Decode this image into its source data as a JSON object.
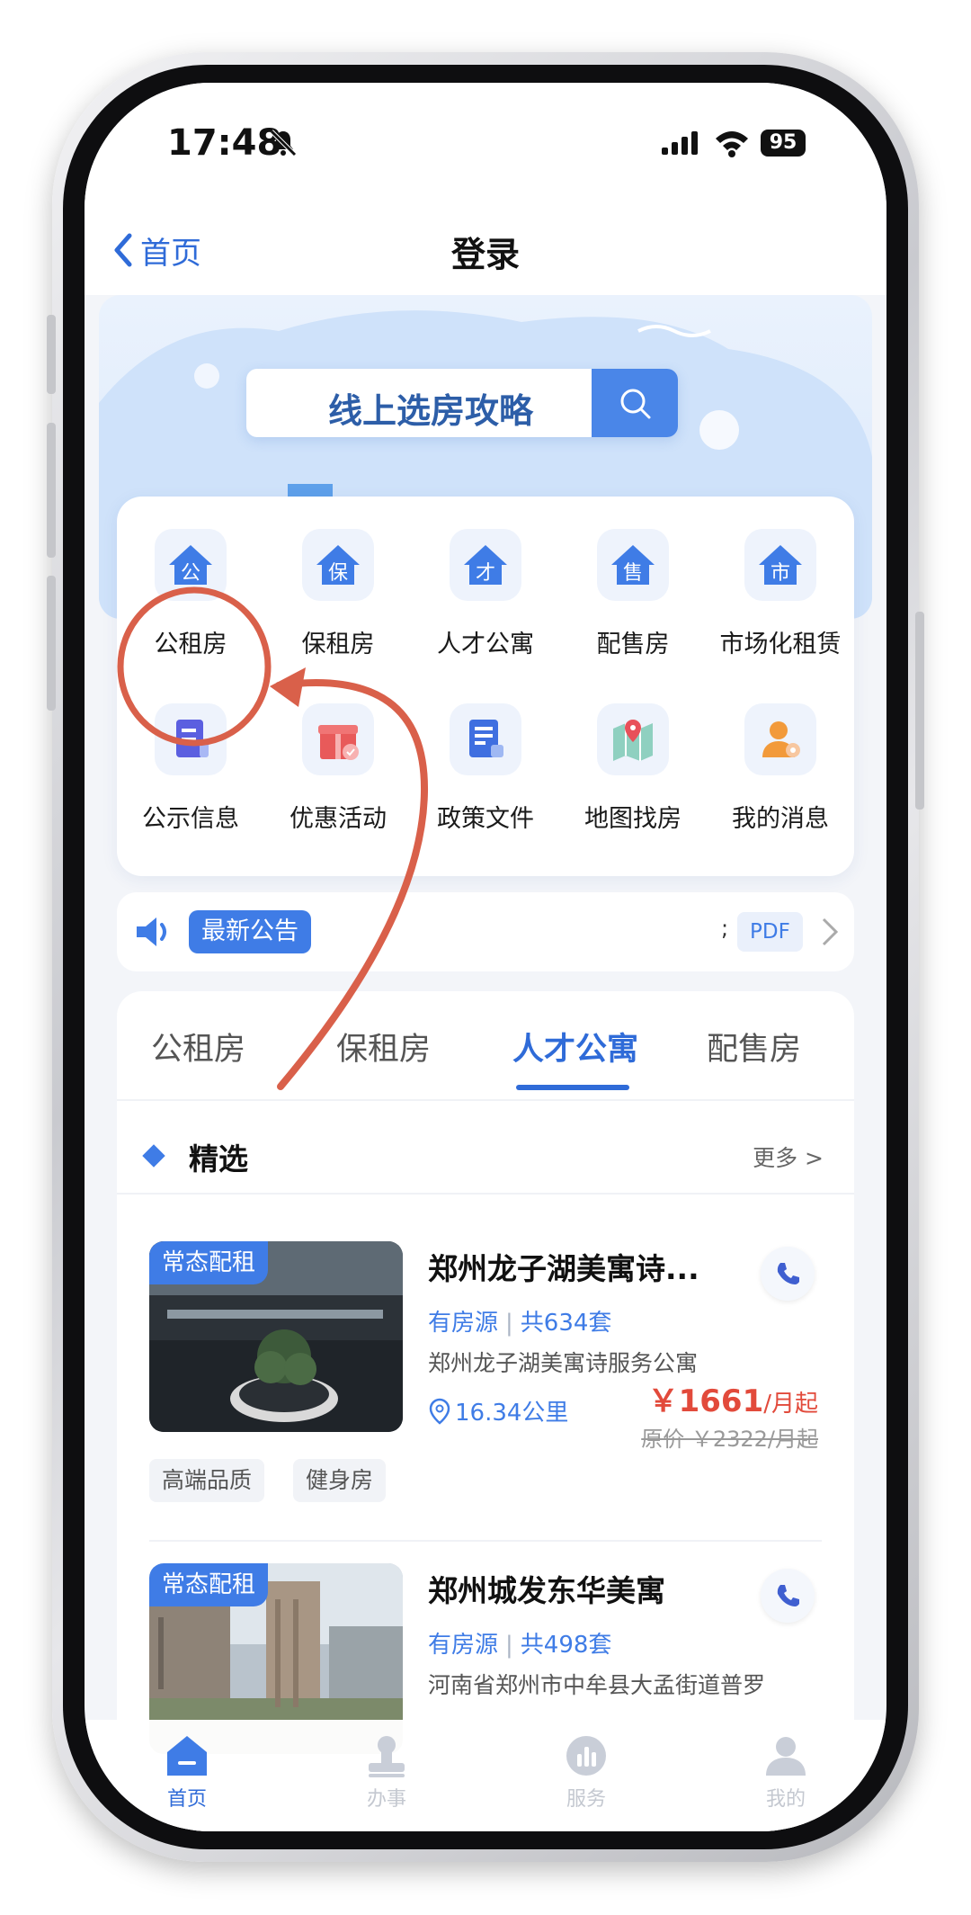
{
  "status_bar": {
    "time": "17:48",
    "battery": "95"
  },
  "nav": {
    "back_label": "首页",
    "title": "登录"
  },
  "banner": {
    "search_placeholder": "线上选房攻略"
  },
  "menu": {
    "items": [
      {
        "label": "公租房",
        "glyph": "公",
        "icon": "house-gong-icon"
      },
      {
        "label": "保租房",
        "glyph": "保",
        "icon": "house-bao-icon"
      },
      {
        "label": "人才公寓",
        "glyph": "才",
        "icon": "house-cai-icon"
      },
      {
        "label": "配售房",
        "glyph": "售",
        "icon": "house-shou-icon"
      },
      {
        "label": "市场化租赁",
        "glyph": "市",
        "icon": "house-shi-icon"
      },
      {
        "label": "公示信息",
        "icon": "document-icon"
      },
      {
        "label": "优惠活动",
        "icon": "gift-icon"
      },
      {
        "label": "政策文件",
        "icon": "policy-file-icon"
      },
      {
        "label": "地图找房",
        "icon": "map-icon"
      },
      {
        "label": "我的消息",
        "icon": "user-message-icon"
      }
    ]
  },
  "notice": {
    "badge": "最新公告",
    "text_fragment": ";",
    "pdf": "PDF"
  },
  "tabs": [
    "公租房",
    "保租房",
    "人才公寓",
    "配售房"
  ],
  "active_tab": "人才公寓",
  "section": {
    "title": "精选",
    "more": "更多 >"
  },
  "listings": [
    {
      "tag": "常态配租",
      "name": "郑州龙子湖美寓诗...",
      "availability": "有房源",
      "count": "共634套",
      "address": "郑州龙子湖美寓诗服务公寓",
      "distance": "16.34公里",
      "price": "￥1661",
      "price_unit": "/月起",
      "original_price": "原价 ￥2322/月起",
      "features": [
        "高端品质",
        "健身房"
      ]
    },
    {
      "tag": "常态配租",
      "name": "郑州城发东华美寓",
      "availability": "有房源",
      "count": "共498套",
      "address": "河南省郑州市中牟县大孟街道普罗"
    }
  ],
  "tab_bar": [
    {
      "label": "首页",
      "icon": "home-icon",
      "active": true
    },
    {
      "label": "办事",
      "icon": "stamp-icon",
      "active": false
    },
    {
      "label": "服务",
      "icon": "chart-icon",
      "active": false
    },
    {
      "label": "我的",
      "icon": "profile-icon",
      "active": false
    }
  ],
  "colors": {
    "accent": "#2f6bd8",
    "badge_blue": "#3f7ce6",
    "price_red": "#e24a3b",
    "annotation_red": "#d9604a"
  }
}
